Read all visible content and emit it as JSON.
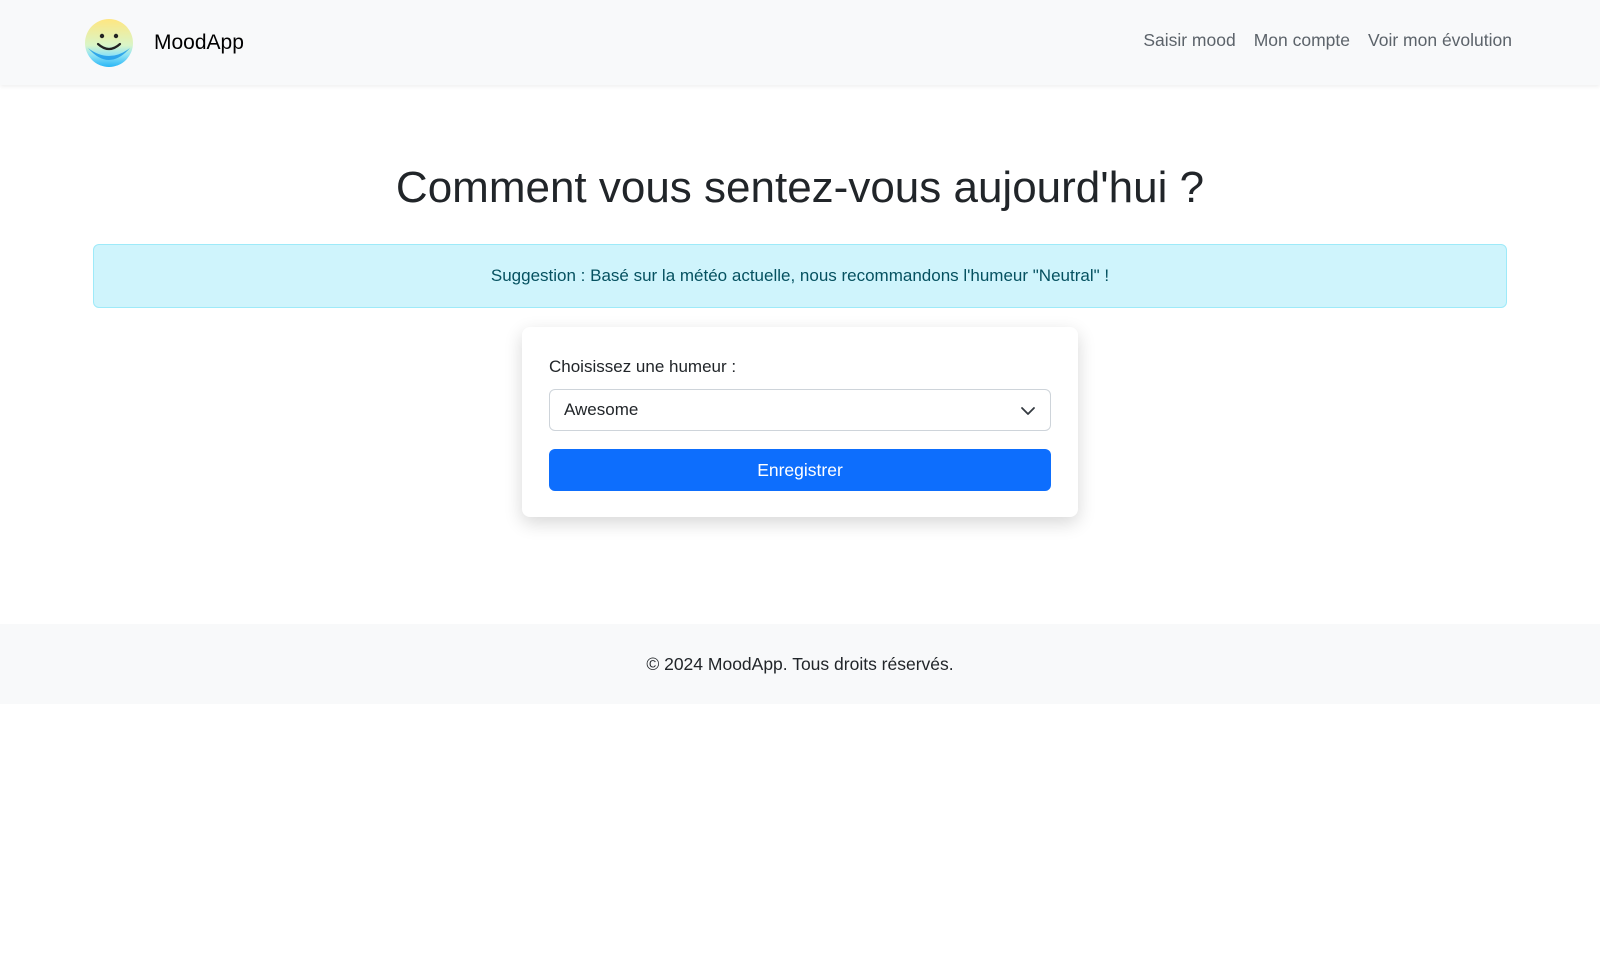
{
  "navbar": {
    "brand_name": "MoodApp",
    "brand_logo_icon": "smiley-face-icon",
    "links": [
      {
        "label": "Saisir mood"
      },
      {
        "label": "Mon compte"
      },
      {
        "label": "Voir mon évolution"
      }
    ]
  },
  "main": {
    "title": "Comment vous sentez-vous aujourd'hui ?",
    "alert_text": "Suggestion : Basé sur la météo actuelle, nous recommandons l'humeur \"Neutral\" !",
    "form": {
      "label": "Choisissez une humeur :",
      "select_value": "Awesome",
      "submit_label": "Enregistrer"
    }
  },
  "footer": {
    "text": "© 2024 MoodApp. Tous droits réservés."
  },
  "colors": {
    "primary": "#0d6efd",
    "alert_bg": "#cff4fc",
    "alert_text": "#055160",
    "navbar_bg": "#f8f9fa"
  }
}
